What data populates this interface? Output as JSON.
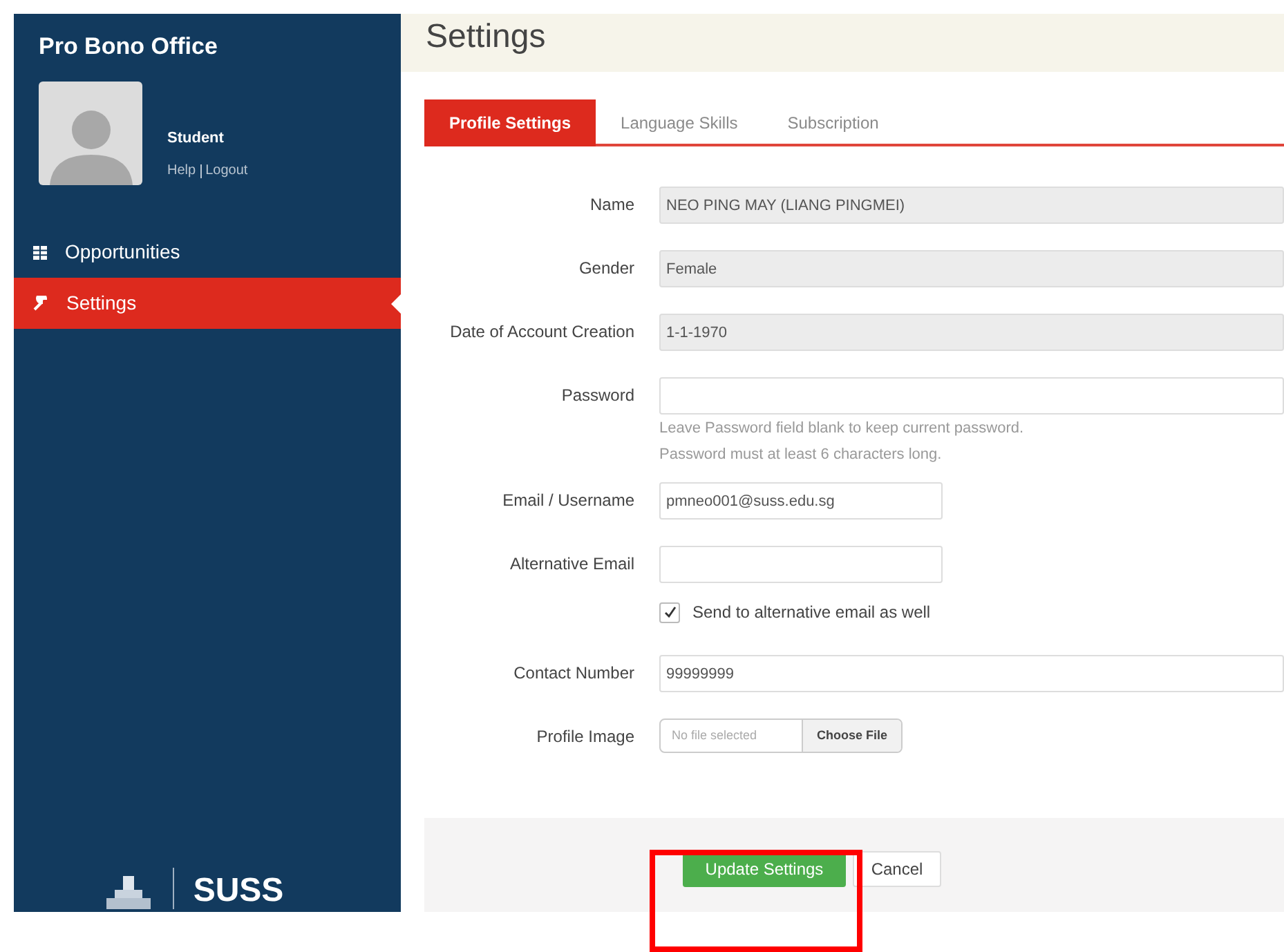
{
  "sidebar": {
    "title": "Pro Bono Office",
    "user": {
      "role": "Student",
      "links": [
        {
          "label": "Help"
        },
        {
          "label": "Logout"
        }
      ]
    },
    "items": [
      {
        "label": "Opportunities",
        "kind": "grid",
        "selected": false
      },
      {
        "label": "Settings",
        "kind": "wrench",
        "selected": true
      }
    ],
    "logo": {
      "text": "SUSS"
    }
  },
  "page": {
    "title": "Settings"
  },
  "tabs": [
    {
      "label": "Profile Settings",
      "selected": true
    },
    {
      "label": "Language Skills",
      "selected": false
    },
    {
      "label": "Subscription",
      "selected": false
    }
  ],
  "form": {
    "fields": [
      {
        "kind": "readonly",
        "label": "Name",
        "value": "NEO PING MAY (LIANG PINGMEI)"
      },
      {
        "kind": "readonly",
        "label": "Gender",
        "value": "Female"
      },
      {
        "kind": "readonly",
        "label": "Date of Account Creation",
        "value": "1-1-1970"
      },
      {
        "kind": "password",
        "label": "Password",
        "hints": [
          "Leave Password field blank to keep current password.",
          "Password must at least 6 characters long."
        ]
      },
      {
        "kind": "short",
        "label": "Email / Username",
        "value": "pmneo001@suss.edu.sg"
      },
      {
        "kind": "short",
        "label": "Alternative Email"
      },
      {
        "kind": "checkbox",
        "label": "Send to alternative email as well",
        "checked": true
      },
      {
        "kind": "text",
        "label": "Contact Number",
        "value": "99999999"
      },
      {
        "kind": "file",
        "label": "Profile Image",
        "status": "No file selected",
        "button": "Choose File"
      }
    ],
    "buttons": [
      {
        "label": "Update Settings",
        "kind": "primary"
      },
      {
        "label": "Cancel",
        "kind": "default"
      }
    ]
  },
  "annotation": {
    "kind": "highlight_box"
  }
}
